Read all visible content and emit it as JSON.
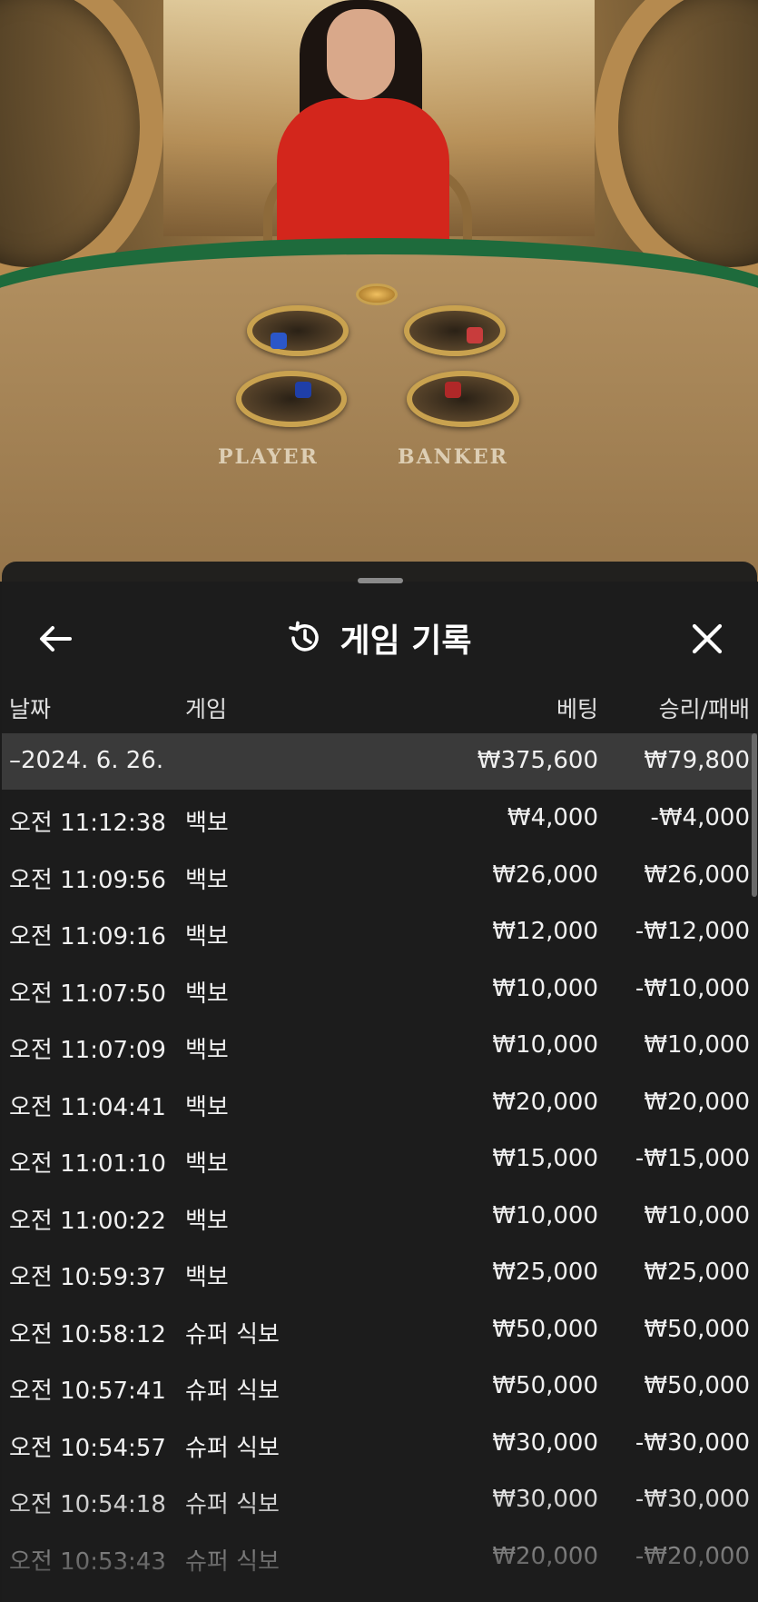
{
  "video": {
    "player_label": "PLAYER",
    "banker_label": "BANKER"
  },
  "panel": {
    "title": "게임 기록",
    "back_icon": "arrow-left-icon",
    "history_icon": "history-clock-icon",
    "close_icon": "close-icon"
  },
  "columns": {
    "date": "날짜",
    "game": "게임",
    "bet": "베팅",
    "win_loss": "승리/패배"
  },
  "summary": {
    "date": "–2024. 6. 26.",
    "bet": "₩375,600",
    "win_loss": "₩79,800"
  },
  "rows": [
    {
      "time": "오전 11:12:38",
      "game": "백보",
      "bet": "₩4,000",
      "win_loss": "-₩4,000"
    },
    {
      "time": "오전 11:09:56",
      "game": "백보",
      "bet": "₩26,000",
      "win_loss": "₩26,000"
    },
    {
      "time": "오전 11:09:16",
      "game": "백보",
      "bet": "₩12,000",
      "win_loss": "-₩12,000"
    },
    {
      "time": "오전 11:07:50",
      "game": "백보",
      "bet": "₩10,000",
      "win_loss": "-₩10,000"
    },
    {
      "time": "오전 11:07:09",
      "game": "백보",
      "bet": "₩10,000",
      "win_loss": "₩10,000"
    },
    {
      "time": "오전 11:04:41",
      "game": "백보",
      "bet": "₩20,000",
      "win_loss": "₩20,000"
    },
    {
      "time": "오전 11:01:10",
      "game": "백보",
      "bet": "₩15,000",
      "win_loss": "-₩15,000"
    },
    {
      "time": "오전 11:00:22",
      "game": "백보",
      "bet": "₩10,000",
      "win_loss": "₩10,000"
    },
    {
      "time": "오전 10:59:37",
      "game": "백보",
      "bet": "₩25,000",
      "win_loss": "₩25,000"
    },
    {
      "time": "오전 10:58:12",
      "game": "슈퍼 식보",
      "bet": "₩50,000",
      "win_loss": "₩50,000"
    },
    {
      "time": "오전 10:57:41",
      "game": "슈퍼 식보",
      "bet": "₩50,000",
      "win_loss": "₩50,000"
    },
    {
      "time": "오전 10:54:57",
      "game": "슈퍼 식보",
      "bet": "₩30,000",
      "win_loss": "-₩30,000"
    },
    {
      "time": "오전 10:54:18",
      "game": "슈퍼 식보",
      "bet": "₩30,000",
      "win_loss": "-₩30,000"
    },
    {
      "time": "오전 10:53:43",
      "game": "슈퍼 식보",
      "bet": "₩20,000",
      "win_loss": "-₩20,000"
    }
  ]
}
